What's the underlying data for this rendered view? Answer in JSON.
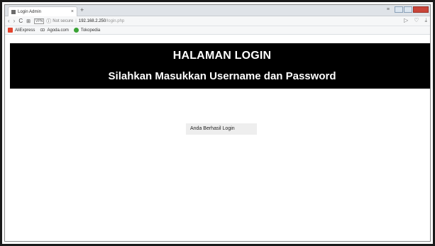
{
  "browser": {
    "tab_title": "Login Admin",
    "tab_close": "×",
    "new_tab": "+",
    "menu_glyph": "≡",
    "nav_back": "‹",
    "nav_forward": "›",
    "nav_reload": "C",
    "grid_glyph": "⊞",
    "vpn_label": "VPN",
    "info_glyph": "ⓘ",
    "not_secure": "Not secure",
    "url_separator": "|",
    "url_host": "192.168.2.250",
    "url_path": "/login.php",
    "right_icons": [
      "▷",
      "♡",
      "⤓"
    ]
  },
  "bookmarks": [
    {
      "label": "AliExpress",
      "icon": "aliexpress-icon"
    },
    {
      "label": "Agoda.com",
      "icon": "agoda-icon"
    },
    {
      "label": "Tokopedia",
      "icon": "tokopedia-icon"
    }
  ],
  "agoda_glyph": "ꝏ",
  "header": {
    "title": "HALAMAN LOGIN",
    "subtitle": "Silahkan Masukkan Username dan Password"
  },
  "message": "Anda Berhasil Login",
  "colors": {
    "header_bg": "#000000",
    "header_text": "#ffffff",
    "notice_bg": "#eeeeee"
  }
}
